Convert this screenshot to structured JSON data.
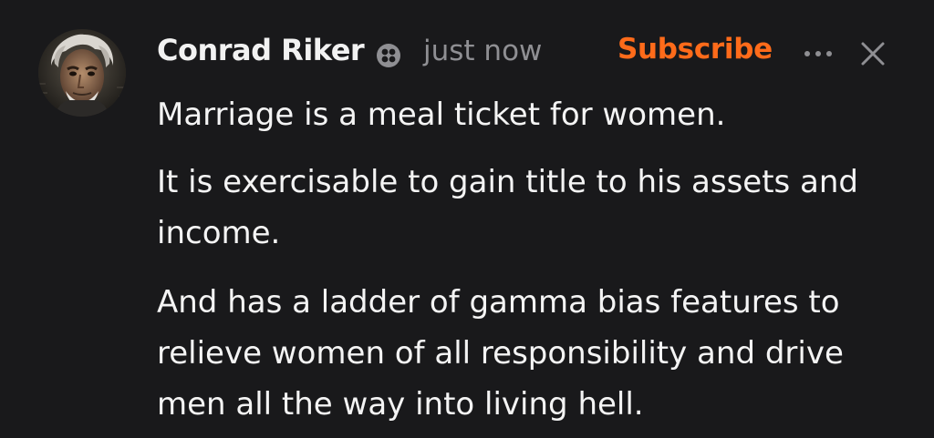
{
  "note": {
    "author_name": "Conrad Riker",
    "badge_icon": "substack-badge-icon",
    "timestamp": "just now",
    "subscribe_label": "Subscribe",
    "more_icon": "ellipsis-icon",
    "close_icon": "close-icon",
    "paragraphs": [
      "Marriage is a meal ticket for women.",
      "It is exercisable to gain title to his assets and income.",
      "And has a ladder of gamma bias features to relieve women of all responsibility and drive men all the way into living hell."
    ]
  },
  "colors": {
    "background": "#19191b",
    "text": "#f4f4f4",
    "muted": "#8f8f93",
    "accent": "#ff6b1a"
  }
}
